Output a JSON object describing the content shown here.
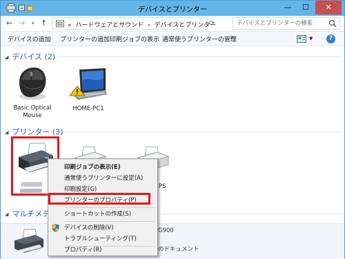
{
  "window": {
    "title": "デバイスとプリンター",
    "controls": {
      "minimize": "—",
      "maximize": "☐",
      "close": "✕"
    }
  },
  "address": {
    "back": "←",
    "forward": "→",
    "up": "↑",
    "prefix": "«",
    "crumb1": "ハードウェアとサウンド",
    "sep": "›",
    "crumb2": "デバイスとプリンター",
    "search_placeholder": "デバイスとプリンターの検索"
  },
  "commands": {
    "add_device": "デバイスの追加",
    "add_printer": "プリンターの追加",
    "print_jobs": "印刷ジョブの表示",
    "set_default": "通常使うプリンターの管理",
    "more": "»"
  },
  "sections": {
    "devices": "デバイス (2)",
    "printers": "プリンター (3)",
    "multimedia": "マルチメディ"
  },
  "devices": [
    {
      "label_line1": "Basic Optical",
      "label_line2": "Mouse"
    },
    {
      "label_line1": "HOME-PC1",
      "label_line2": ""
    }
  ],
  "printer_partial_label": "PS",
  "details": {
    "model_partial": "G900",
    "status_partial": "のドキュメント"
  },
  "context_menu": {
    "items": [
      {
        "label": "印刷ジョブの表示(E)",
        "bold": true
      },
      {
        "label": "通常使うプリンターに設定(A)"
      },
      {
        "label": "印刷設定(G)"
      },
      {
        "label": "プリンターのプロパティ(P)"
      },
      {
        "label": "ショートカットの作成(S)"
      },
      {
        "label": "デバイスの削除(V)"
      },
      {
        "label": "トラブルシューティング(T)"
      },
      {
        "label": "プロパティ(R)"
      }
    ]
  },
  "colors": {
    "titlebar": "#63b5e7",
    "close": "#c75050",
    "section_header": "#1e5ea8",
    "annotation_red": "#e3161b"
  }
}
